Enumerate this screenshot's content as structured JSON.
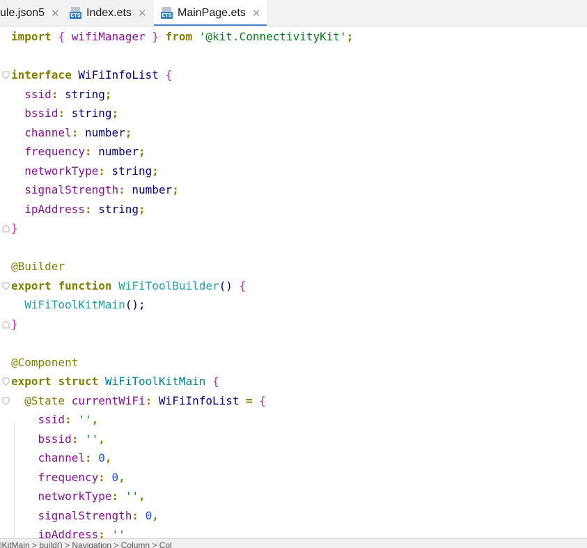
{
  "tabs": [
    {
      "label": "ule.json5",
      "icon": "json-file-icon",
      "active": false
    },
    {
      "label": "Index.ets",
      "icon": "ets-file-icon",
      "active": false
    },
    {
      "label": "MainPage.ets",
      "icon": "ets-file-icon",
      "active": true
    }
  ],
  "ets_badge_text": "ETS",
  "close_glyph": "✕",
  "code_lines": [
    [
      {
        "t": "import",
        "c": "kw2"
      },
      {
        "t": " ",
        "c": "pu"
      },
      {
        "t": "{",
        "c": "br"
      },
      {
        "t": " wifiManager ",
        "c": "pr"
      },
      {
        "t": "}",
        "c": "br"
      },
      {
        "t": " ",
        "c": "pu"
      },
      {
        "t": "from",
        "c": "kw2"
      },
      {
        "t": " ",
        "c": "pu"
      },
      {
        "t": "'@kit.ConnectivityKit'",
        "c": "str"
      },
      {
        "t": ";",
        "c": "kw2"
      }
    ],
    [],
    [
      {
        "t": "interface",
        "c": "kw2"
      },
      {
        "t": " WiFiInfoList ",
        "c": "ty"
      },
      {
        "t": "{",
        "c": "br"
      }
    ],
    [
      {
        "t": "  ssid",
        "c": "pr"
      },
      {
        "t": ": ",
        "c": "kw2"
      },
      {
        "t": "string",
        "c": "ty"
      },
      {
        "t": ";",
        "c": "kw2"
      }
    ],
    [
      {
        "t": "  bssid",
        "c": "pr"
      },
      {
        "t": ": ",
        "c": "kw2"
      },
      {
        "t": "string",
        "c": "ty"
      },
      {
        "t": ";",
        "c": "kw2"
      }
    ],
    [
      {
        "t": "  channel",
        "c": "pr"
      },
      {
        "t": ": ",
        "c": "kw2"
      },
      {
        "t": "number",
        "c": "ty"
      },
      {
        "t": ";",
        "c": "kw2"
      }
    ],
    [
      {
        "t": "  frequency",
        "c": "pr"
      },
      {
        "t": ": ",
        "c": "kw2"
      },
      {
        "t": "number",
        "c": "ty"
      },
      {
        "t": ";",
        "c": "kw2"
      }
    ],
    [
      {
        "t": "  networkType",
        "c": "pr"
      },
      {
        "t": ": ",
        "c": "kw2"
      },
      {
        "t": "string",
        "c": "ty"
      },
      {
        "t": ";",
        "c": "kw2"
      }
    ],
    [
      {
        "t": "  signalStrength",
        "c": "pr"
      },
      {
        "t": ": ",
        "c": "kw2"
      },
      {
        "t": "number",
        "c": "ty"
      },
      {
        "t": ";",
        "c": "kw2"
      }
    ],
    [
      {
        "t": "  ipAddress",
        "c": "pr"
      },
      {
        "t": ": ",
        "c": "kw2"
      },
      {
        "t": "string",
        "c": "ty"
      },
      {
        "t": ";",
        "c": "kw2"
      }
    ],
    [
      {
        "t": "}",
        "c": "br"
      }
    ],
    [],
    [
      {
        "t": "@Builder",
        "c": "ann"
      }
    ],
    [
      {
        "t": "export",
        "c": "kw2"
      },
      {
        "t": " ",
        "c": "pu"
      },
      {
        "t": "function",
        "c": "kw2"
      },
      {
        "t": " ",
        "c": "pu"
      },
      {
        "t": "WiFiToolBuilder",
        "c": "fn2"
      },
      {
        "t": "() ",
        "c": "ty"
      },
      {
        "t": "{",
        "c": "br"
      }
    ],
    [
      {
        "t": "  WiFiToolKitMain",
        "c": "fn2"
      },
      {
        "t": "();",
        "c": "ty"
      }
    ],
    [
      {
        "t": "}",
        "c": "br"
      }
    ],
    [],
    [
      {
        "t": "@Component",
        "c": "ann"
      }
    ],
    [
      {
        "t": "export",
        "c": "kw2"
      },
      {
        "t": " ",
        "c": "pu"
      },
      {
        "t": "struct",
        "c": "kw2"
      },
      {
        "t": " WiFiToolKitMain ",
        "c": "st"
      },
      {
        "t": "{",
        "c": "br"
      }
    ],
    [
      {
        "t": "  @State",
        "c": "ann"
      },
      {
        "t": " currentWiFi",
        "c": "pr"
      },
      {
        "t": ": ",
        "c": "kw2"
      },
      {
        "t": "WiFiInfoList",
        "c": "ty"
      },
      {
        "t": " = ",
        "c": "kw2"
      },
      {
        "t": "{",
        "c": "br"
      }
    ],
    [
      {
        "t": "    ssid",
        "c": "pr"
      },
      {
        "t": ": ",
        "c": "kw2"
      },
      {
        "t": "''",
        "c": "str"
      },
      {
        "t": ",",
        "c": "kw2"
      }
    ],
    [
      {
        "t": "    bssid",
        "c": "pr"
      },
      {
        "t": ": ",
        "c": "kw2"
      },
      {
        "t": "''",
        "c": "str"
      },
      {
        "t": ",",
        "c": "kw2"
      }
    ],
    [
      {
        "t": "    channel",
        "c": "pr"
      },
      {
        "t": ": ",
        "c": "kw2"
      },
      {
        "t": "0",
        "c": "num"
      },
      {
        "t": ",",
        "c": "kw2"
      }
    ],
    [
      {
        "t": "    frequency",
        "c": "pr"
      },
      {
        "t": ": ",
        "c": "kw2"
      },
      {
        "t": "0",
        "c": "num"
      },
      {
        "t": ",",
        "c": "kw2"
      }
    ],
    [
      {
        "t": "    networkType",
        "c": "pr"
      },
      {
        "t": ": ",
        "c": "kw2"
      },
      {
        "t": "''",
        "c": "str"
      },
      {
        "t": ",",
        "c": "kw2"
      }
    ],
    [
      {
        "t": "    signalStrength",
        "c": "pr"
      },
      {
        "t": ": ",
        "c": "kw2"
      },
      {
        "t": "0",
        "c": "num"
      },
      {
        "t": ",",
        "c": "kw2"
      }
    ],
    [
      {
        "t": "    ipAddress",
        "c": "pr"
      },
      {
        "t": ": ",
        "c": "kw2"
      },
      {
        "t": "''",
        "c": "str"
      }
    ]
  ],
  "fold_markers": [
    {
      "line": 2,
      "kind": "open"
    },
    {
      "line": 10,
      "kind": "close"
    },
    {
      "line": 13,
      "kind": "open"
    },
    {
      "line": 15,
      "kind": "close"
    },
    {
      "line": 18,
      "kind": "open"
    },
    {
      "line": 19,
      "kind": "open"
    }
  ],
  "status_breadcrumb": "lKitMain  >  build()  >  Navigation  >  Column  >  Col"
}
